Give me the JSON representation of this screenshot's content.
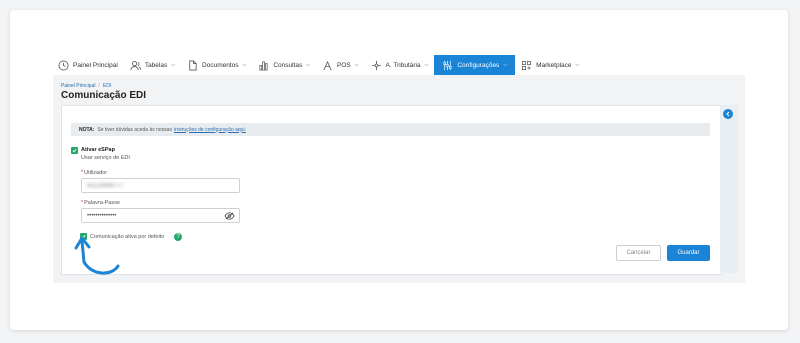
{
  "nav": {
    "items": [
      {
        "label": "Painel Principal",
        "icon": "clock-icon",
        "dropdown": false
      },
      {
        "label": "Tabelas",
        "icon": "users-icon",
        "dropdown": true
      },
      {
        "label": "Documentos",
        "icon": "document-icon",
        "dropdown": true
      },
      {
        "label": "Consultas",
        "icon": "bar-chart-icon",
        "dropdown": true
      },
      {
        "label": "POS",
        "icon": "pos-icon",
        "dropdown": true
      },
      {
        "label": "A. Tributária",
        "icon": "network-icon",
        "dropdown": true
      },
      {
        "label": "Configurações",
        "icon": "settings-icon",
        "dropdown": true,
        "active": true
      },
      {
        "label": "Marketplace",
        "icon": "grid-icon",
        "dropdown": true
      }
    ]
  },
  "breadcrumb": {
    "home": "Painel Principal",
    "current": "EDI"
  },
  "page_title": "Comunicação EDI",
  "note": {
    "prefix": "NOTA:",
    "text": "Se tiver dúvidas aceda às nossas",
    "link": "instruções de configuração aqui."
  },
  "form": {
    "activate_label": "Ativar eSPap",
    "activate_sub": "Usar serviço de EDI",
    "user_label": "Utilizador",
    "user_value": "ex123456777",
    "password_label": "Palavra-Passe",
    "password_value": "••••••••••••••",
    "default_label": "Comunicação ativa por defeito",
    "help": "?"
  },
  "buttons": {
    "cancel": "Cancelar",
    "save": "Guardar"
  },
  "colors": {
    "accent": "#1a84d6",
    "success": "#27a86a"
  }
}
